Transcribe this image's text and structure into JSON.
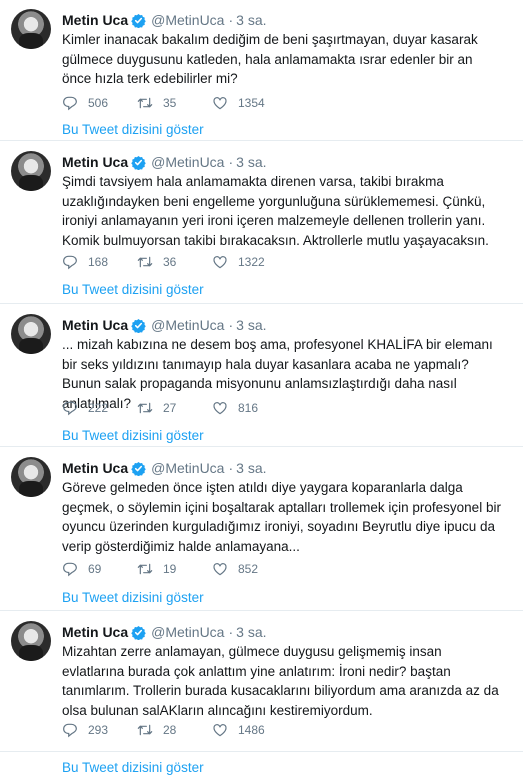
{
  "user": {
    "display_name": "Metin Uca",
    "handle": "@MetinUca",
    "verified_badge_color": "#1da1f2"
  },
  "thread_link_label": "Bu Tweet dizisini göster",
  "tweets": [
    {
      "time": "3 sa.",
      "text": "Kimler inanacak bakalım dediğim de beni şaşırtmayan, duyar kasarak gülmece duygusunu katleden, hala anlamamakta ısrar edenler bir an önce hızla terk edebilirler mi?",
      "replies": "506",
      "retweets": "35",
      "likes": "1354"
    },
    {
      "time": "3 sa.",
      "text": "Şimdi tavsiyem hala anlamamakta direnen varsa, takibi bırakma uzaklığındayken beni engelleme yorgunluğuna sürüklememesi. Çünkü, ironiyi anlamayanın yeri ironi içeren malzemeyle dellenen trollerin yanı. Komik bulmuyorsan takibi bırakacaksın. Aktrollerle mutlu yaşayacaksın.",
      "replies": "168",
      "retweets": "36",
      "likes": "1322"
    },
    {
      "time": "3 sa.",
      "text": "... mizah kabızına ne desem boş ama, profesyonel KHALİFA bir elemanı bir seks yıldızını tanımayıp hala duyar kasanlara acaba ne yapmalı? Bunun salak propaganda misyonunu anlamsızlaştırdığı daha nasıl anlatılmalı?",
      "replies": "222",
      "retweets": "27",
      "likes": "816"
    },
    {
      "time": "3 sa.",
      "text": "Göreve gelmeden önce işten atıldı diye yaygara koparanlarla dalga geçmek, o söylemin içini boşaltarak aptalları trollemek için profesyonel bir oyuncu üzerinden kurguladığımız ironiyi, soyadını Beyrutlu diye ipucu da verip gösterdiğimiz halde anlamayana...",
      "replies": "69",
      "retweets": "19",
      "likes": "852"
    },
    {
      "time": "3 sa.",
      "text": "Mizahtan zerre anlamayan, gülmece duygusu gelişmemiş insan evlatlarına burada çok anlattım yine anlatırım: İroni nedir? baştan tanımlarım. Trollerin burada kusacaklarını biliyordum ama aranızda az da olsa bulunan salAKların alıncağını kestiremiyordum.",
      "replies": "293",
      "retweets": "28",
      "likes": "1486"
    }
  ]
}
